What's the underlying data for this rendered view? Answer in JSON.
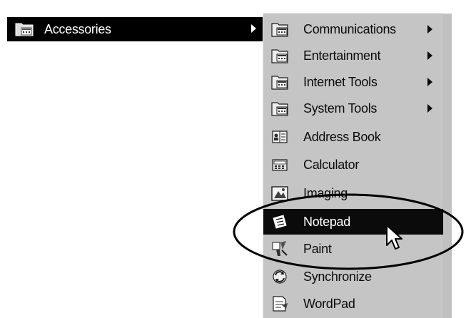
{
  "start_menu": {
    "parent_item": {
      "label": "Accessories",
      "icon": "program-group-folder-icon",
      "has_submenu": true
    }
  },
  "accessories_menu": {
    "items": [
      {
        "label": "Communications",
        "icon": "program-group-folder-icon",
        "has_submenu": true,
        "active": false
      },
      {
        "label": "Entertainment",
        "icon": "program-group-folder-icon",
        "has_submenu": true,
        "active": false
      },
      {
        "label": "Internet Tools",
        "icon": "program-group-folder-icon",
        "has_submenu": true,
        "active": false
      },
      {
        "label": "System Tools",
        "icon": "program-group-folder-icon",
        "has_submenu": true,
        "active": false
      },
      {
        "label": "Address Book",
        "icon": "address-book-icon",
        "has_submenu": false,
        "active": false
      },
      {
        "label": "Calculator",
        "icon": "calculator-icon",
        "has_submenu": false,
        "active": false
      },
      {
        "label": "Imaging",
        "icon": "imaging-icon",
        "has_submenu": false,
        "active": false
      },
      {
        "label": "Notepad",
        "icon": "notepad-icon",
        "has_submenu": false,
        "active": true
      },
      {
        "label": "Paint",
        "icon": "paint-icon",
        "has_submenu": false,
        "active": false
      },
      {
        "label": "Synchronize",
        "icon": "synchronize-icon",
        "has_submenu": false,
        "active": false
      },
      {
        "label": "WordPad",
        "icon": "wordpad-icon",
        "has_submenu": false,
        "active": false
      }
    ]
  },
  "colors": {
    "menu_bg": "#c2c2c2",
    "highlight_bg": "#111111",
    "highlight_text": "#ffffff"
  }
}
